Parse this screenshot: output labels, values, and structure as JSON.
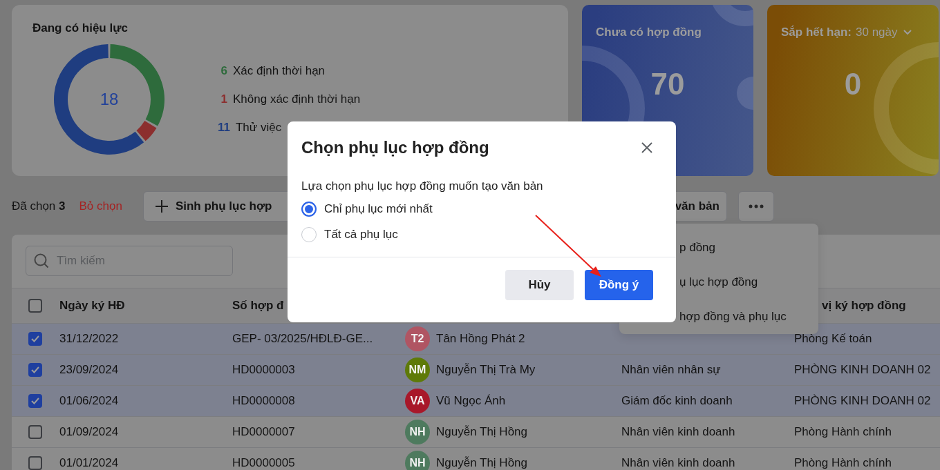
{
  "summary": {
    "title": "Đang có hiệu lực",
    "total": "18",
    "legend": [
      {
        "count": "6",
        "label": "Xác định thời hạn",
        "color": "#2e6b3c"
      },
      {
        "count": "1",
        "label": "Không xác định thời hạn",
        "color": "#8c2e2e"
      },
      {
        "count": "11",
        "label": "Thử việc",
        "color": "#1f3d80"
      }
    ]
  },
  "stat_cards": [
    {
      "kind": "plain",
      "title": "Chưa có hợp đồng",
      "value": "70",
      "color": "#2b3e80"
    },
    {
      "kind": "dropdown",
      "title": "Sắp hết hạn:",
      "filter": "30 ngày",
      "value": "0",
      "color": "#7b4d06"
    }
  ],
  "selection": {
    "label": "Đã chọn",
    "count": "3",
    "clear": "Bỏ chọn"
  },
  "actions": [
    {
      "kind": "add",
      "label": "Sinh phụ lục hợp"
    },
    {
      "kind": "text",
      "label": "văn bản"
    },
    {
      "kind": "more"
    }
  ],
  "menu": {
    "items": [
      {
        "label": "p đồng"
      },
      {
        "label": "ụ lục hợp đồng"
      },
      {
        "label": "hợp đồng và phụ lục"
      }
    ]
  },
  "search": {
    "placeholder": "Tìm kiếm"
  },
  "table": {
    "select_all": false,
    "columns": [
      {
        "kind": "date",
        "label": "Ngày ký HĐ"
      },
      {
        "kind": "number",
        "label": "Số hợp đ"
      },
      {
        "kind": "unit",
        "label": "vị ký hợp đồng"
      }
    ],
    "rows": [
      {
        "selected": true,
        "date": "31/12/2022",
        "number": "GEP- 03/2025/HĐLĐ-GE...",
        "initials": "T2",
        "color": "#b05563",
        "name": "Tân Hồng Phát 2",
        "unit": "Phòng Kế toán"
      },
      {
        "selected": true,
        "date": "23/09/2024",
        "number": "HD0000003",
        "initials": "NM",
        "color": "#5e7a08",
        "name": "Nguyễn Thị Trà My",
        "position": "Nhân viên nhân sự",
        "unit": "PHÒNG KINH DOANH 02"
      },
      {
        "selected": true,
        "date": "01/06/2024",
        "number": "HD0000008",
        "initials": "VA",
        "color": "#a8182a",
        "name": "Vũ Ngọc Ánh",
        "position": "Giám đốc kinh doanh",
        "unit": "PHÒNG KINH DOANH 02"
      },
      {
        "selected": false,
        "date": "01/09/2024",
        "number": "HD0000007",
        "initials": "NH",
        "color": "#4e7a5e",
        "name": "Nguyễn Thị Hồng",
        "position": "Nhân viên kinh doanh",
        "unit": "Phòng Hành chính"
      },
      {
        "selected": false,
        "date": "01/01/2024",
        "number": "HD0000005",
        "initials": "NH",
        "color": "#4e7a5e",
        "name": "Nguyễn Thị Hồng",
        "position": "Nhân viên kinh doanh",
        "unit": "Phòng Hành chính"
      }
    ]
  },
  "dialog": {
    "title": "Chọn phụ lục hợp đồng",
    "description": "Lựa chọn phụ lục hợp đồng muốn tạo văn bản",
    "options": [
      {
        "label": "Chỉ phụ lục mới nhất",
        "selected": true
      },
      {
        "label": "Tất cả phụ lục",
        "selected": false
      }
    ],
    "buttons": [
      {
        "kind": "secondary",
        "label": "Hủy"
      },
      {
        "kind": "primary",
        "label": "Đồng ý"
      }
    ]
  },
  "annotation": {
    "kind": "arrow"
  }
}
